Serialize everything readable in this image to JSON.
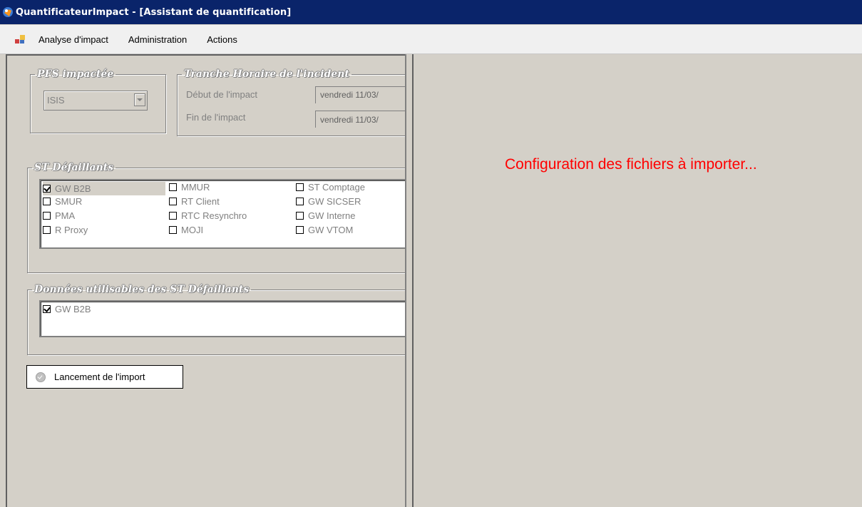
{
  "window": {
    "title": "QuantificateurImpact - [Assistant de quantification]",
    "icon": "app-icon"
  },
  "menu": {
    "items": [
      "Analyse d'impact",
      "Administration",
      "Actions"
    ]
  },
  "pfs": {
    "legend": "PFS impactée",
    "value": "ISIS"
  },
  "tranche": {
    "legend": "Tranche Horaire de l'incident",
    "debut_label": "Début de l'impact",
    "debut_value": "vendredi 11/03/",
    "fin_label": "Fin de l'impact",
    "fin_value": "vendredi 11/03/"
  },
  "st_defaillants": {
    "legend": "ST Défaillants",
    "items": [
      {
        "label": "GW B2B",
        "checked": true
      },
      {
        "label": "MMUR",
        "checked": false
      },
      {
        "label": "ST Comptage",
        "checked": false
      },
      {
        "label": "SMUR",
        "checked": false
      },
      {
        "label": "RT Client",
        "checked": false
      },
      {
        "label": "GW SICSER",
        "checked": false
      },
      {
        "label": "PMA",
        "checked": false
      },
      {
        "label": "RTC Resynchro",
        "checked": false
      },
      {
        "label": "GW Interne",
        "checked": false
      },
      {
        "label": "R Proxy",
        "checked": false
      },
      {
        "label": "MOJI",
        "checked": false
      },
      {
        "label": "GW VTOM",
        "checked": false
      }
    ]
  },
  "donnees": {
    "legend": "Données utilisables des ST Défaillants",
    "items": [
      {
        "label": "GW B2B",
        "checked": true
      }
    ]
  },
  "import_button": {
    "label": "Lancement de l'import"
  },
  "status": {
    "message": "Configuration des fichiers à importer...",
    "color": "#ff0000"
  }
}
